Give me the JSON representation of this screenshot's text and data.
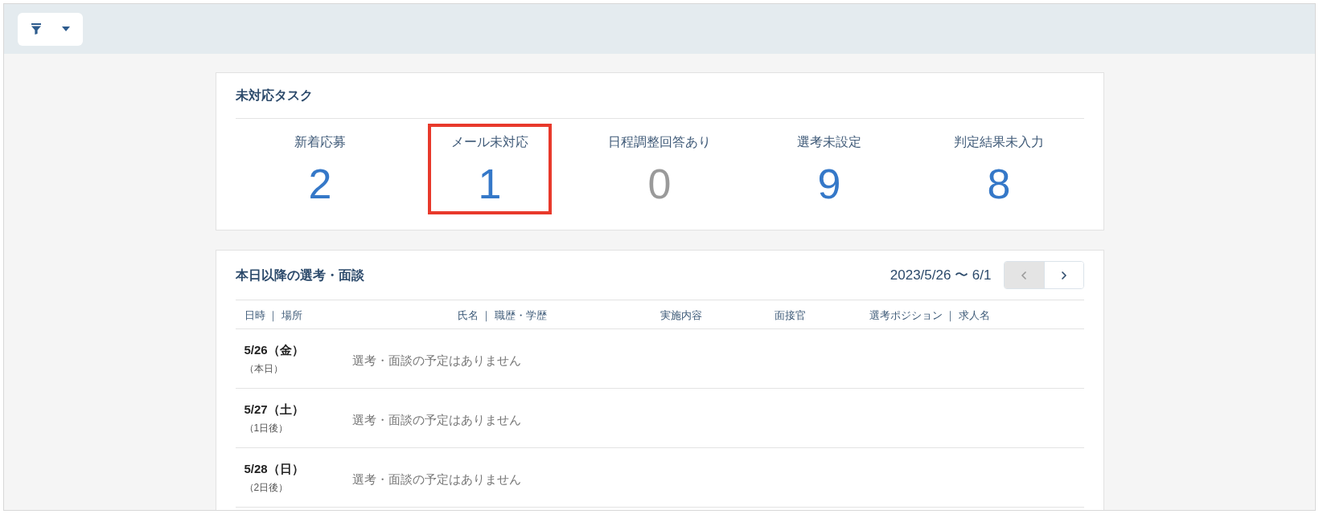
{
  "tasks": {
    "title": "未対応タスク",
    "items": [
      {
        "label": "新着応募",
        "count": "2",
        "muted": false,
        "highlighted": false
      },
      {
        "label": "メール未対応",
        "count": "1",
        "muted": false,
        "highlighted": true
      },
      {
        "label": "日程調整回答あり",
        "count": "0",
        "muted": true,
        "highlighted": false
      },
      {
        "label": "選考未設定",
        "count": "9",
        "muted": false,
        "highlighted": false
      },
      {
        "label": "判定結果未入力",
        "count": "8",
        "muted": false,
        "highlighted": false
      }
    ]
  },
  "schedule": {
    "title": "本日以降の選考・面談",
    "date_range": "2023/5/26 〜 6/1",
    "pager": [
      {
        "kind": "prev",
        "disabled": true
      },
      {
        "kind": "next",
        "disabled": false
      }
    ],
    "columns": [
      "日時 ｜ 場所",
      "氏名 ｜ 職歴・学歴",
      "実施内容",
      "面接官",
      "選考ポジション ｜ 求人名"
    ],
    "rows": [
      {
        "date": "5/26（金）",
        "relative": "（本日）",
        "message": "選考・面談の予定はありません"
      },
      {
        "date": "5/27（土）",
        "relative": "（1日後）",
        "message": "選考・面談の予定はありません"
      },
      {
        "date": "5/28（日）",
        "relative": "（2日後）",
        "message": "選考・面談の予定はありません"
      }
    ]
  }
}
